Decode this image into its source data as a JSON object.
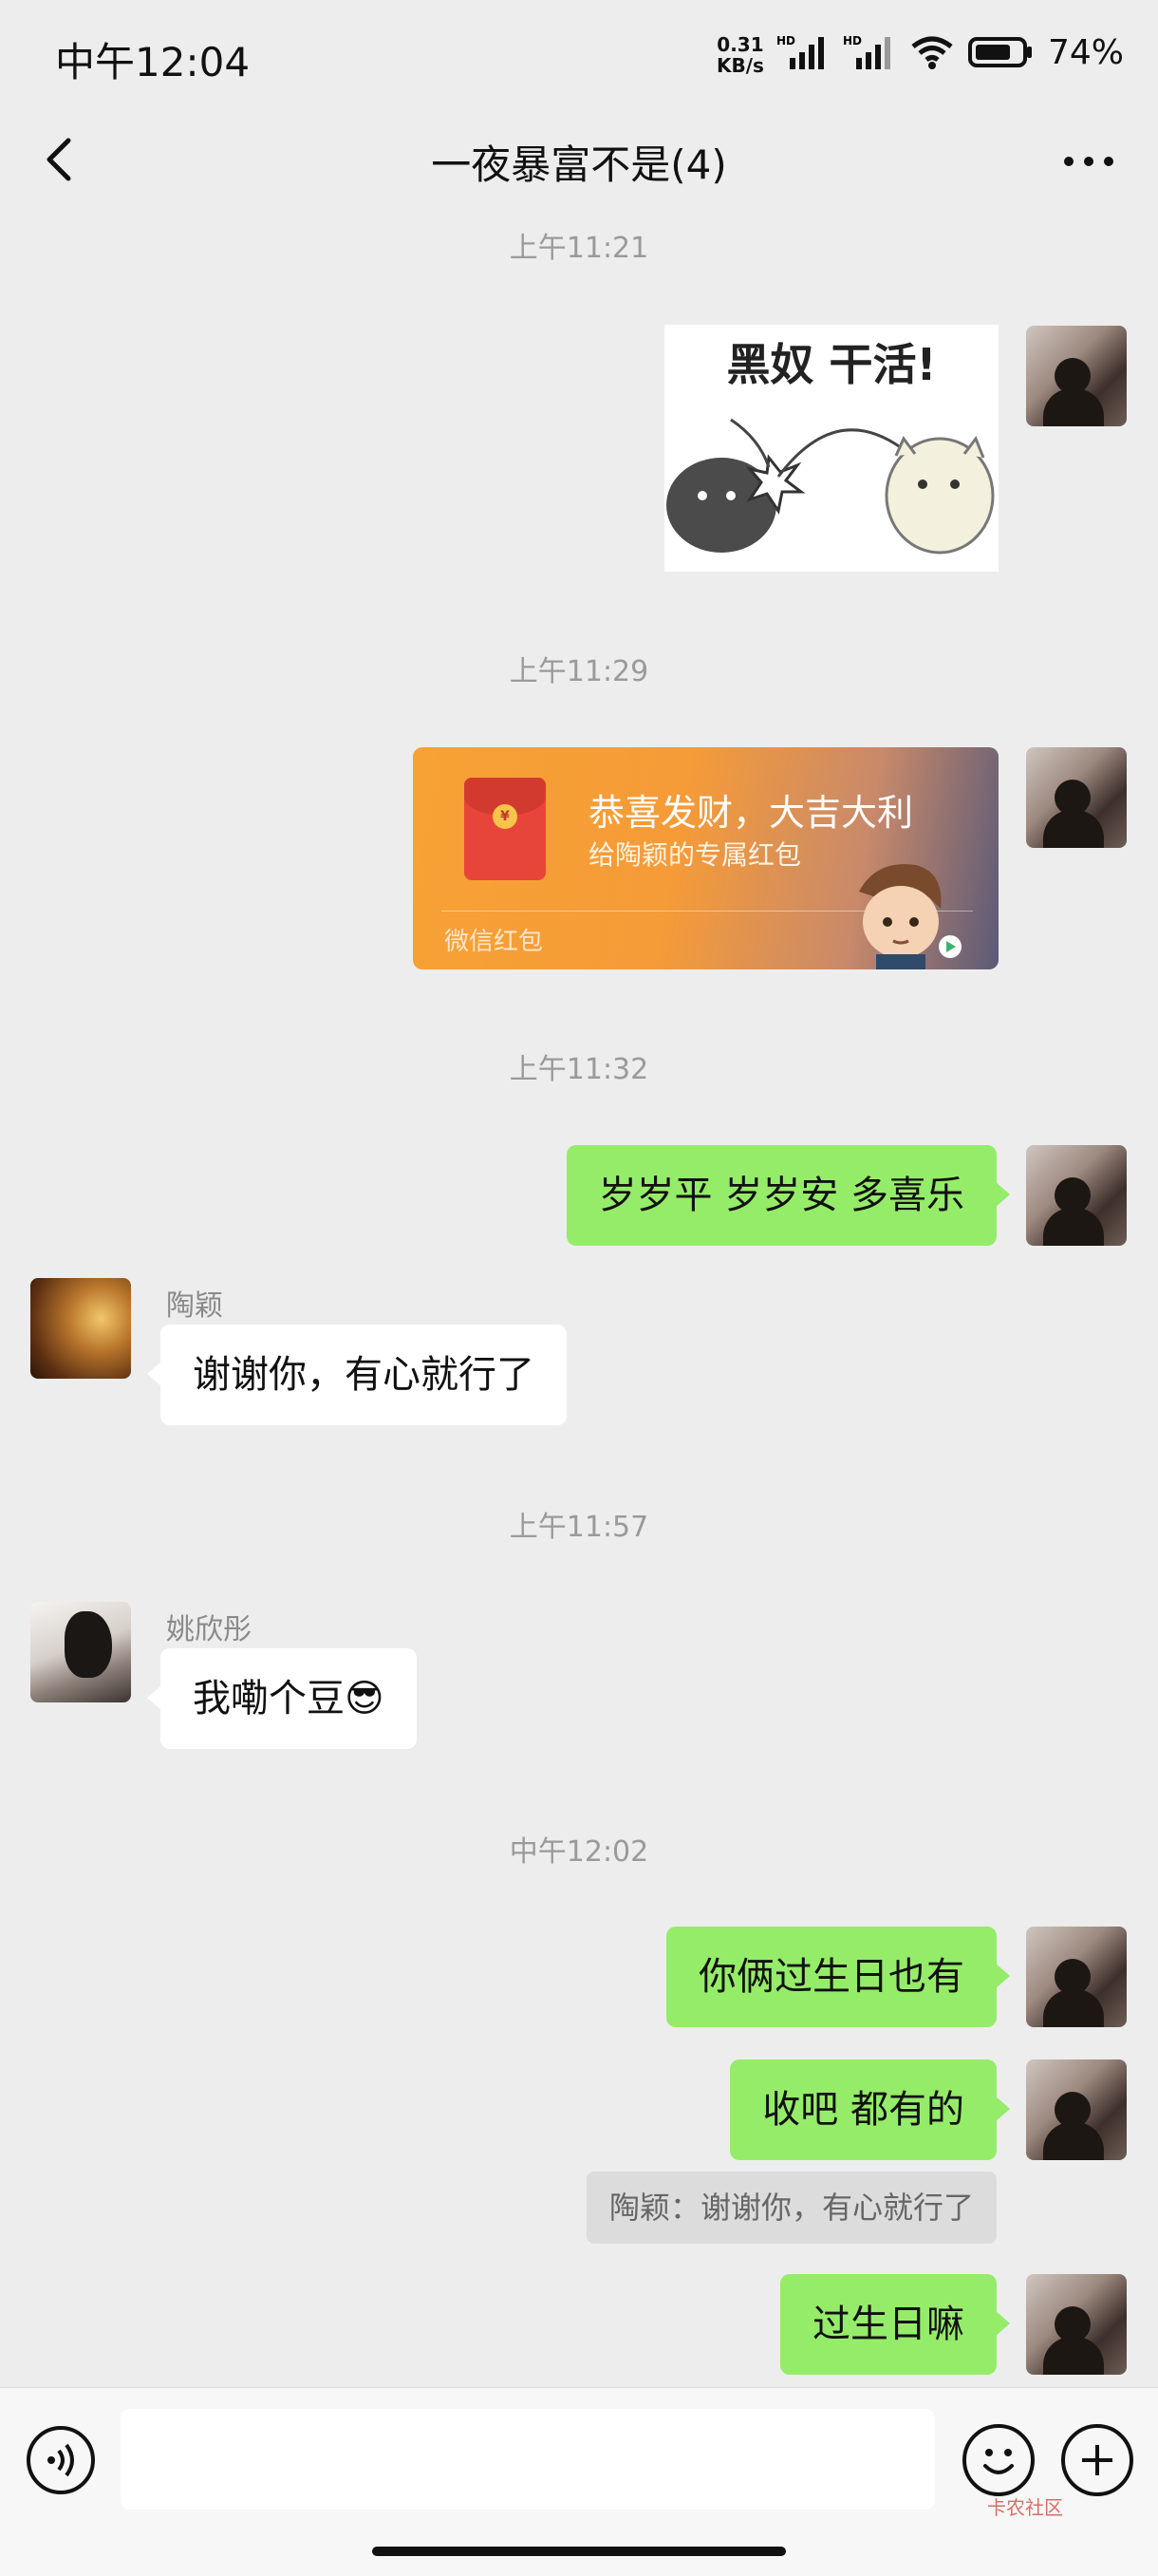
{
  "status_bar": {
    "time": "中午12:04",
    "net_speed_value": "0.31",
    "net_speed_unit": "KB/s",
    "battery": "74%",
    "icons": [
      "signal-hd-icon",
      "signal-hd-icon",
      "wifi-icon",
      "battery-icon"
    ]
  },
  "header": {
    "title": "一夜暴富不是(4)",
    "back_icon": "chevron-left-icon",
    "more_icon": "ellipsis-icon"
  },
  "messages": {
    "ts1": "上午11:21",
    "sticker_text": "黑奴 干活!",
    "ts2": "上午11:29",
    "red_packet": {
      "title": "恭喜发财，大吉大利",
      "subtitle": "给陶颖的专属红包",
      "footer": "微信红包",
      "coin": "¥"
    },
    "ts3": "上午11:32",
    "msg_me_1": "岁岁平 岁岁安 多喜乐",
    "tao_name": "陶颖",
    "msg_tao_1": "谢谢你，有心就行了",
    "ts4": "上午11:57",
    "yao_name": "姚欣彤",
    "msg_yao_1": "我嘞个豆😎",
    "ts5": "中午12:02",
    "msg_me_2": "你俩过生日也有",
    "msg_me_3": "收吧 都有的",
    "quote_me_3": "陶颖：谢谢你，有心就行了",
    "msg_me_4": "过生日嘛"
  },
  "input_bar": {
    "voice_icon": "voice-icon",
    "emoji_icon": "emoji-icon",
    "plus_icon": "plus-icon",
    "watermark": "卡农社区"
  }
}
